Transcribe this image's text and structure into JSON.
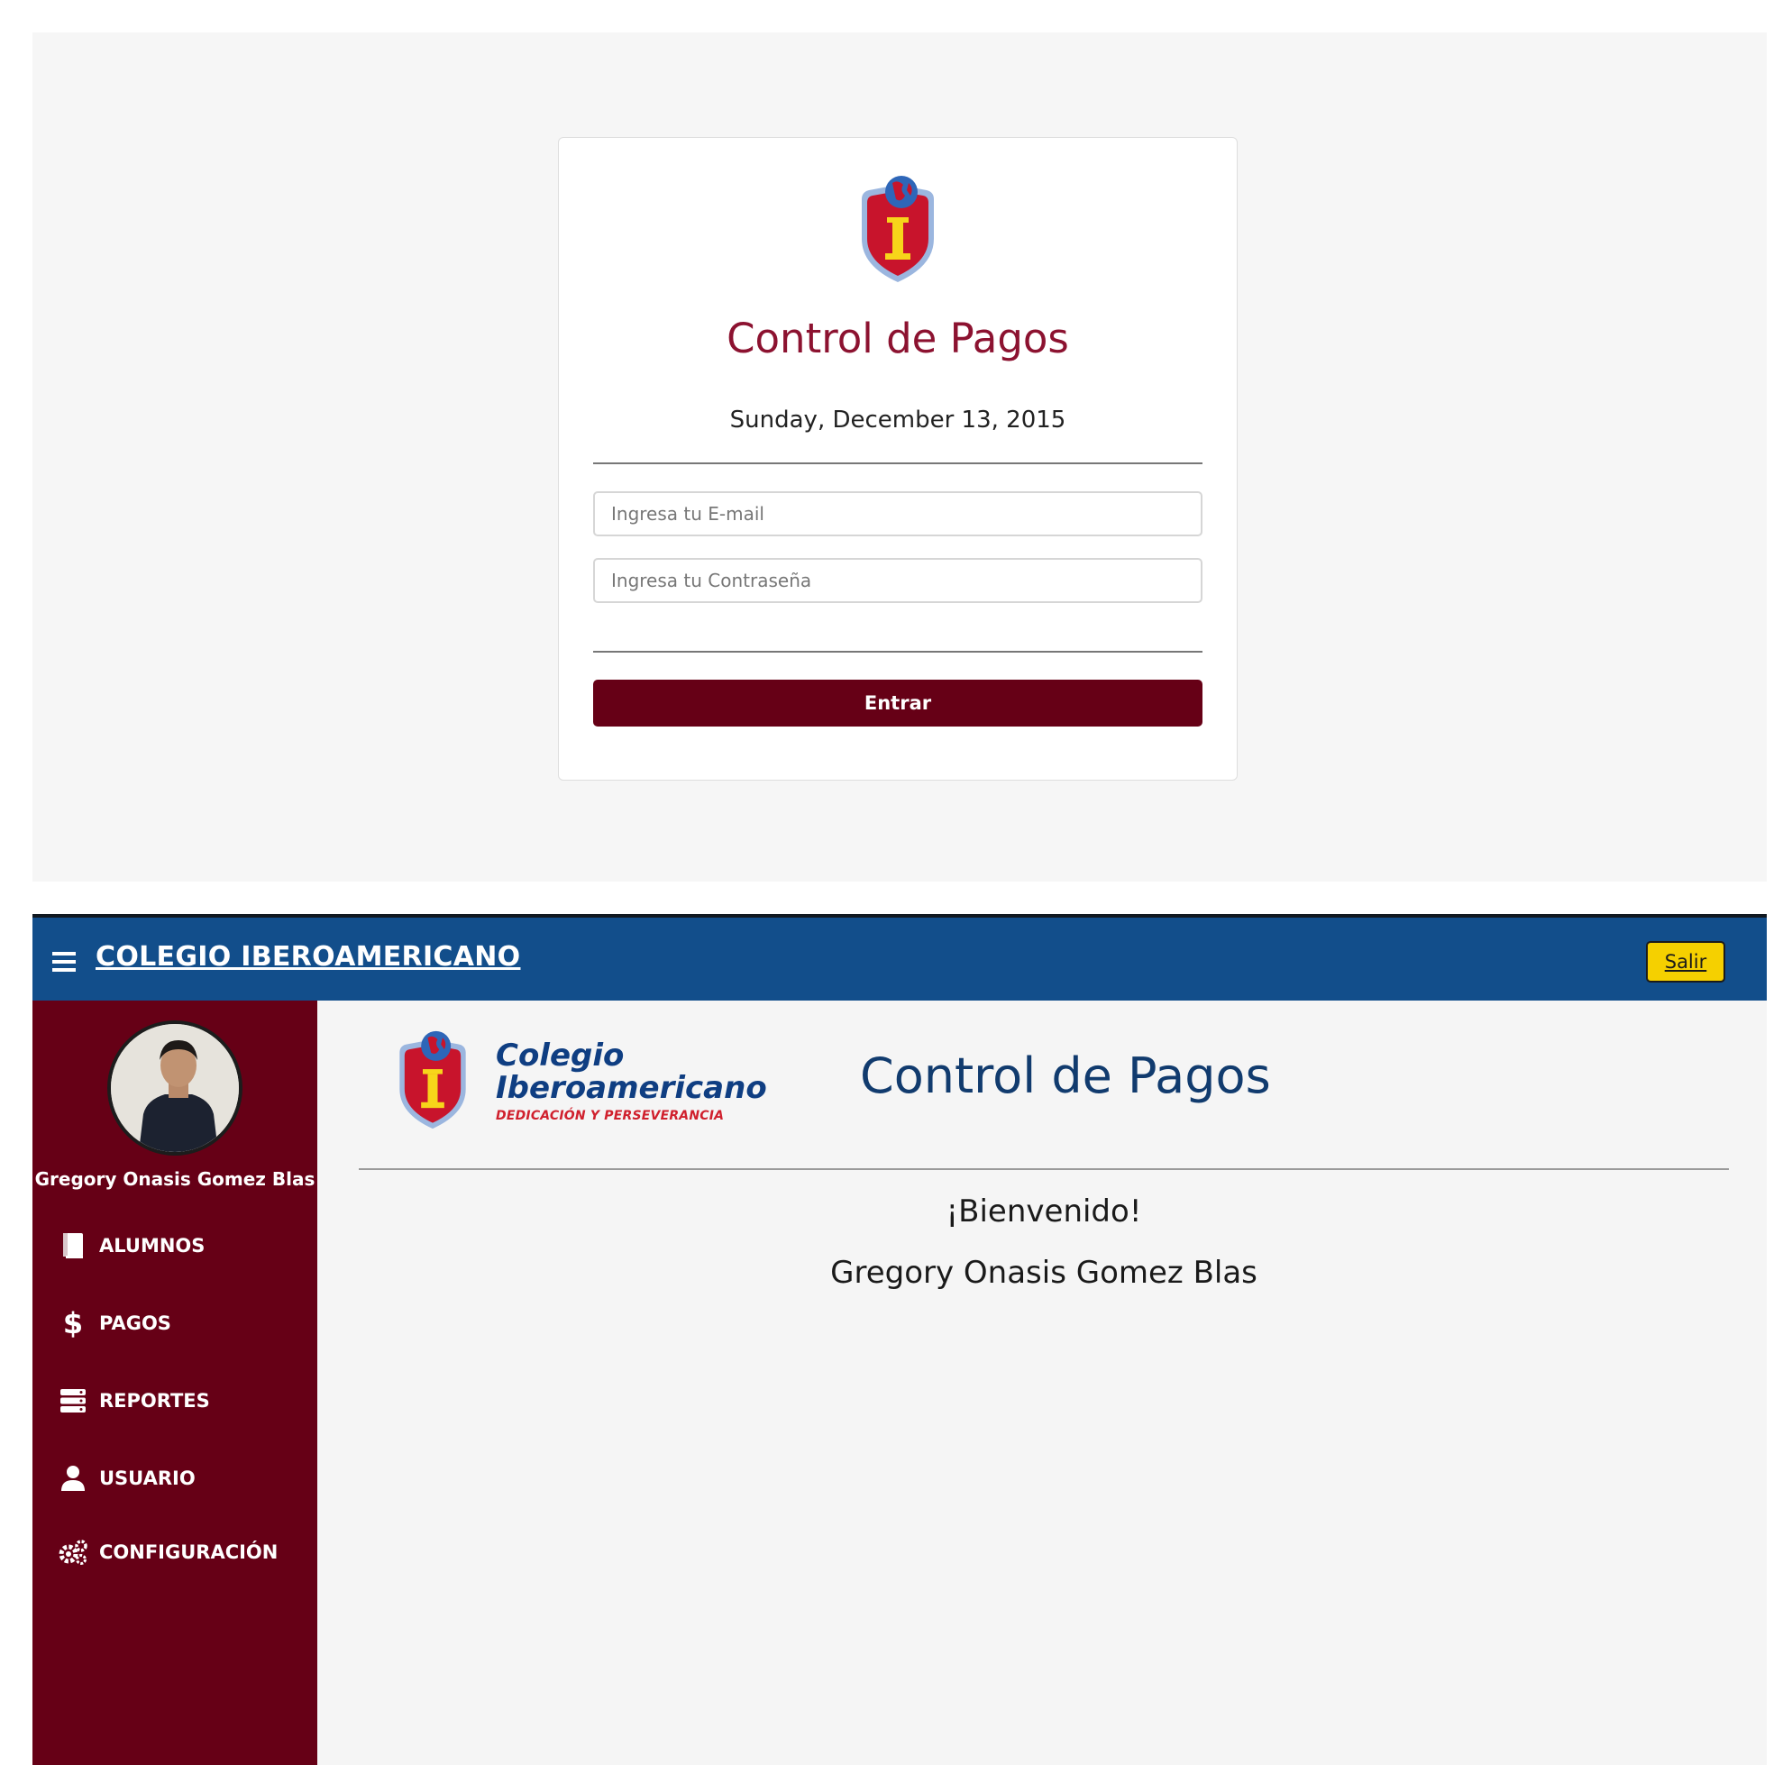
{
  "login": {
    "logo_icon": "school-shield-logo",
    "title": "Control de Pagos",
    "date": "Sunday, December 13, 2015",
    "email_placeholder": "Ingresa tu E-mail",
    "password_placeholder": "Ingresa tu Contraseña",
    "submit_label": "Entrar",
    "accent_color": "#660016"
  },
  "dashboard": {
    "navbar": {
      "menu_icon": "hamburger-menu-icon",
      "brand": "COLEGIO IBEROAMERICANO",
      "logout_label": "Salir",
      "background_color": "#124e8b"
    },
    "sidebar": {
      "user_name": "Gregory Onasis Gomez Blas",
      "items": [
        {
          "label": "ALUMNOS",
          "icon": "book-icon"
        },
        {
          "label": "PAGOS",
          "icon": "dollar-icon"
        },
        {
          "label": "REPORTES",
          "icon": "server-stack-icon"
        },
        {
          "label": "USUARIO",
          "icon": "user-icon"
        },
        {
          "label": "CONFIGURACIÓN",
          "icon": "gears-icon"
        }
      ],
      "background_color": "#660016"
    },
    "main": {
      "brand_line1": "Colegio",
      "brand_line2": "Iberoamericano",
      "brand_tagline": "DEDICACIÓN Y PERSEVERANCIA",
      "title": "Control de Pagos",
      "welcome": "¡Bienvenido!",
      "user_name": "Gregory Onasis Gomez Blas"
    }
  }
}
